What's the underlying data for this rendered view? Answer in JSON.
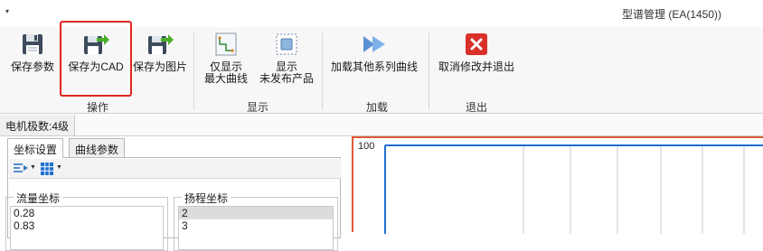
{
  "window": {
    "title": "型谱管理 (EA(1450))",
    "quick_access": "▾"
  },
  "ribbon": {
    "groups": {
      "operate": "操作",
      "display": "显示",
      "load": "加载",
      "exit": "退出"
    },
    "buttons": {
      "save_params": "保存参数",
      "save_cad": "保存为CAD",
      "save_image": "保存为图片",
      "show_max_curve": [
        "仅显示",
        "最大曲线"
      ],
      "show_unpublished": [
        "显示",
        "未发布产品"
      ],
      "load_series": "加载其他系列曲线",
      "cancel_exit": "取消修改并退出"
    },
    "highlighted_button": "save_cad"
  },
  "motor": {
    "label": "电机极数:4级"
  },
  "panel": {
    "tabs": [
      "坐标设置",
      "曲线参数"
    ],
    "active_tab": 0,
    "flow": {
      "title": "流量坐标",
      "values": [
        "0.28",
        "0.83"
      ]
    },
    "head": {
      "title": "扬程坐标",
      "values": [
        "2",
        "3"
      ],
      "selected_index": 0
    }
  },
  "chart_data": {
    "type": "line",
    "title": "",
    "xlabel": "",
    "ylabel": "",
    "y_tick_labels": [
      "100"
    ],
    "grid": true,
    "series": []
  },
  "colors": {
    "highlight": "#e0261f",
    "chart_border": "#e05a3a",
    "axis": "#1e6fd0",
    "grid": "#c8c8c8"
  }
}
